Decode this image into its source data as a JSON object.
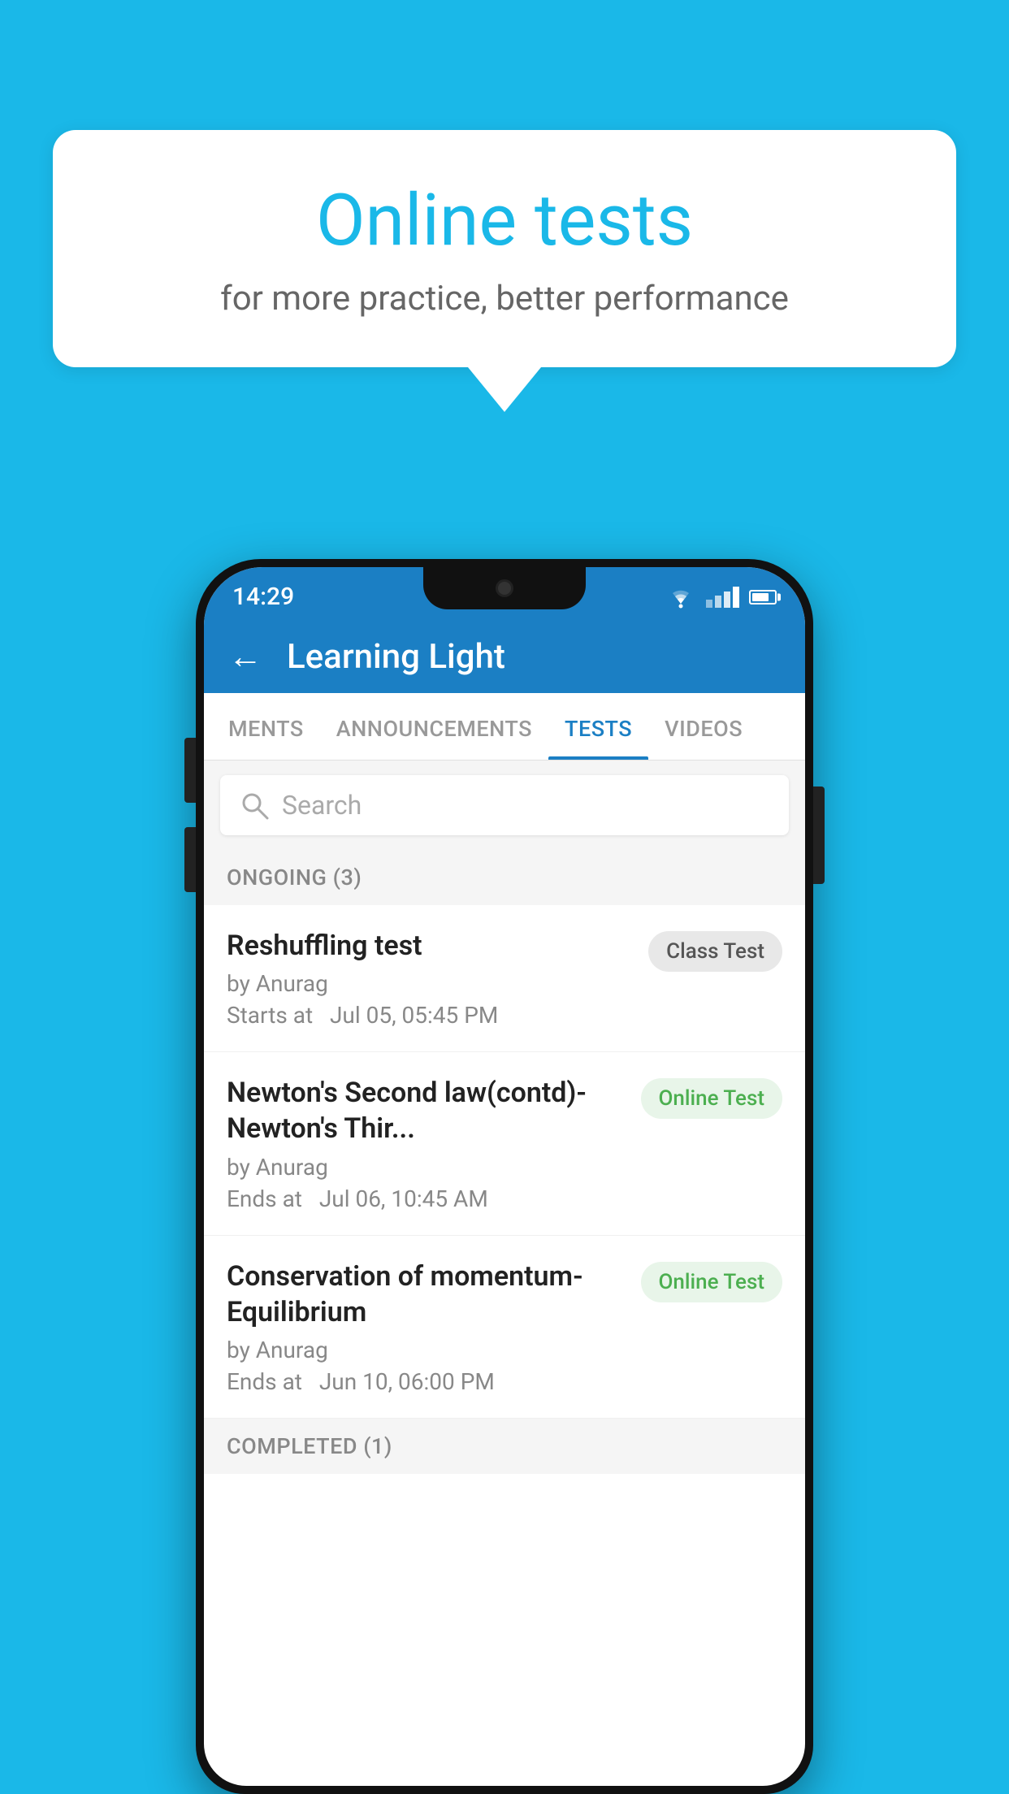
{
  "background_color": "#1ab8e8",
  "speech_bubble": {
    "title": "Online tests",
    "subtitle": "for more practice, better performance"
  },
  "phone": {
    "status_bar": {
      "time": "14:29"
    },
    "app_header": {
      "title": "Learning Light"
    },
    "tabs": [
      {
        "label": "MENTS",
        "active": false
      },
      {
        "label": "ANNOUNCEMENTS",
        "active": false
      },
      {
        "label": "TESTS",
        "active": true
      },
      {
        "label": "VIDEOS",
        "active": false
      }
    ],
    "search": {
      "placeholder": "Search"
    },
    "ongoing_section": {
      "title": "ONGOING (3)"
    },
    "test_items": [
      {
        "name": "Reshuffling test",
        "author": "by Anurag",
        "time_label": "Starts at",
        "time_value": "Jul 05, 05:45 PM",
        "badge": "Class Test",
        "badge_type": "class"
      },
      {
        "name": "Newton's Second law(contd)-Newton's Thir...",
        "author": "by Anurag",
        "time_label": "Ends at",
        "time_value": "Jul 06, 10:45 AM",
        "badge": "Online Test",
        "badge_type": "online"
      },
      {
        "name": "Conservation of momentum-Equilibrium",
        "author": "by Anurag",
        "time_label": "Ends at",
        "time_value": "Jun 10, 06:00 PM",
        "badge": "Online Test",
        "badge_type": "online"
      }
    ],
    "completed_section": {
      "title": "COMPLETED (1)"
    }
  }
}
